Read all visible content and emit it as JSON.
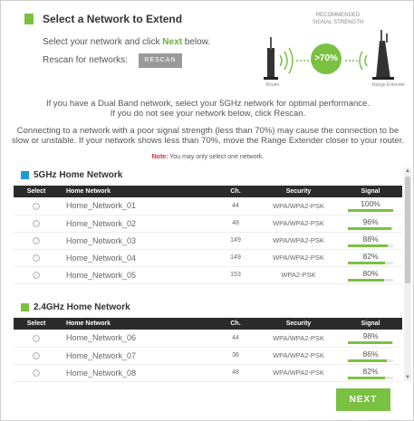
{
  "header": {
    "title": "Select a Network to Extend",
    "instruction_prefix": "Select your network and click ",
    "instruction_action": "Next",
    "instruction_suffix": " below.",
    "rescan_label": "Rescan for networks:",
    "rescan_button": "RESCAN"
  },
  "graphic": {
    "recommended_line1": "RECOMMENDED",
    "recommended_line2": "SIGNAL STRENGTH",
    "percent": ">70%",
    "router_label": "Router",
    "extender_label": "Range Extender"
  },
  "info": {
    "line1": "If you have a Dual Band network, select your 5GHz network for optimal performance.",
    "line2": "If you do not see your network below, click Rescan.",
    "line3": "Connecting to a network with a poor signal strength (less than 70%) may cause the connection to be",
    "line4": "slow or unstable. If your network shows less than 70%, move the Range Extender closer to your router.",
    "note_label": "Note:",
    "note_text": " You may only select one network."
  },
  "columns": {
    "select": "Select",
    "network": "Home Network",
    "channel": "Ch.",
    "security": "Security",
    "signal": "Signal"
  },
  "band_5ghz": {
    "title": "5GHz Home Network",
    "rows": [
      {
        "name": "Home_Network_01",
        "channel": "44",
        "security": "WPA/WPA2-PSK",
        "signal": "100%",
        "level": 1.0
      },
      {
        "name": "Home_Network_02",
        "channel": "48",
        "security": "WPA/WPA2-PSK",
        "signal": "96%",
        "level": 0.96
      },
      {
        "name": "Home_Network_03",
        "channel": "149",
        "security": "WPA/WPA2-PSK",
        "signal": "88%",
        "level": 0.88
      },
      {
        "name": "Home_Network_04",
        "channel": "149",
        "security": "WPA/WPA2-PSK",
        "signal": "82%",
        "level": 0.82
      },
      {
        "name": "Home_Network_05",
        "channel": "153",
        "security": "WPA2-PSK",
        "signal": "80%",
        "level": 0.8
      }
    ]
  },
  "band_24ghz": {
    "title": "2.4GHz Home Network",
    "rows": [
      {
        "name": "Home_Network_06",
        "channel": "44",
        "security": "WPA/WPA2-PSK",
        "signal": "98%",
        "level": 0.98
      },
      {
        "name": "Home_Network_07",
        "channel": "36",
        "security": "WPA/WPA2-PSK",
        "signal": "86%",
        "level": 0.86
      },
      {
        "name": "Home_Network_08",
        "channel": "48",
        "security": "WPA/WPA2-PSK",
        "signal": "82%",
        "level": 0.82
      }
    ]
  },
  "footer": {
    "next_button": "NEXT"
  },
  "colors": {
    "accent_green": "#7ac142",
    "band_5ghz": "#1e9bd7",
    "band_24ghz": "#7ac142",
    "note_red": "#d0312d"
  }
}
